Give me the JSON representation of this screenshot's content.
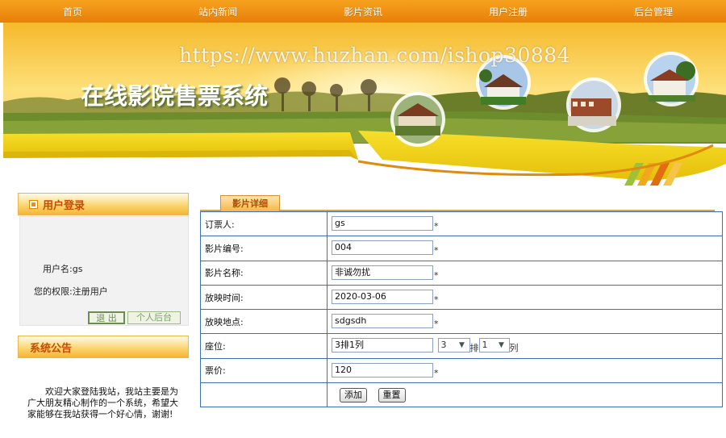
{
  "nav": {
    "items": [
      "首页",
      "站内新闻",
      "影片资讯",
      "用户注册",
      "后台管理"
    ]
  },
  "banner": {
    "watermark": "https://www.huzhan.com/ishop30884",
    "title": "在线影院售票系统"
  },
  "login": {
    "title": "用户登录",
    "user_line": "用户名:gs",
    "perm_line": "您的权限:注册用户",
    "logout_label": "退 出",
    "backend_label": "个人后台"
  },
  "notice": {
    "title": "系统公告",
    "text": "欢迎大家登陆我站，我站主要是为广大朋友精心制作的一个系统，希望大家能够在我站获得一个好心情，谢谢!"
  },
  "detail": {
    "tab_label": "影片详细",
    "rows": [
      {
        "label": "订票人:",
        "value": "gs",
        "req": "*"
      },
      {
        "label": "影片编号:",
        "value": "004",
        "req": "*"
      },
      {
        "label": "影片名称:",
        "value": "非诚勿扰",
        "req": "*"
      },
      {
        "label": "放映时间:",
        "value": "2020-03-06",
        "req": "*"
      },
      {
        "label": "放映地点:",
        "value": "sdgsdh",
        "req": "*"
      },
      {
        "label": "票价:",
        "value": "120",
        "req": "*"
      }
    ],
    "seat": {
      "label": "座位:",
      "value": "3排1列",
      "row_select": "3",
      "row_unit": "排",
      "col_select": "1",
      "col_unit": "列"
    },
    "add_label": "添加",
    "reset_label": "重置"
  },
  "colors": {
    "nav_orange": "#f39412",
    "table_border": "#3b73b4",
    "panel_title": "#c94a00"
  }
}
